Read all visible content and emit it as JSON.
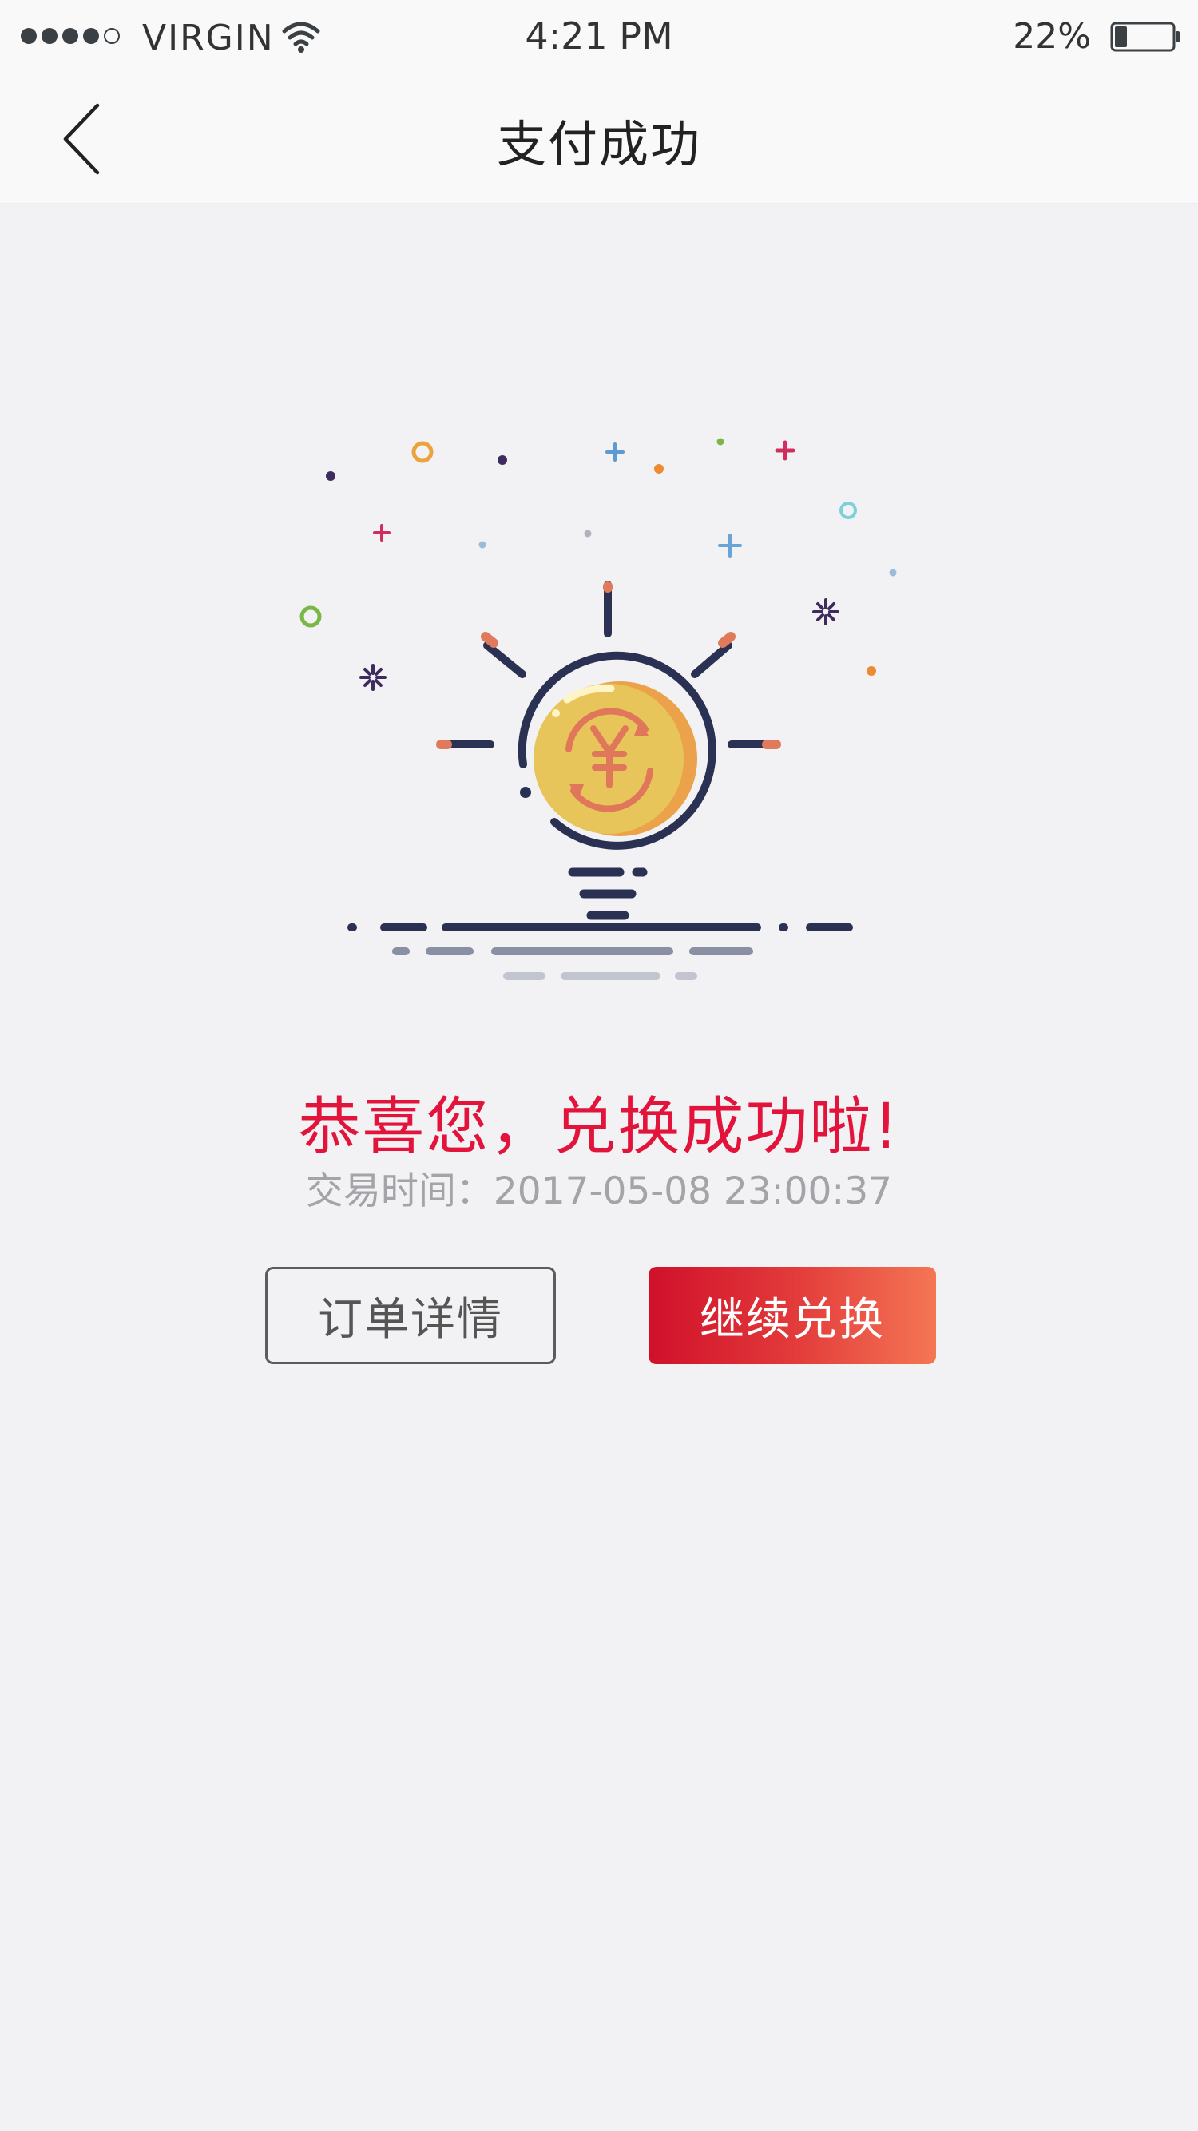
{
  "status_bar": {
    "signal_bars_filled": 4,
    "signal_bars_total": 5,
    "carrier": "VIRGIN",
    "wifi_icon": "wifi-icon",
    "time": "4:21 PM",
    "battery_percent": "22%",
    "battery_level": 0.22,
    "battery_icon": "battery-icon"
  },
  "nav": {
    "back_icon": "chevron-left-icon",
    "title": "支付成功"
  },
  "illustration": {
    "icon": "lightbulb-yen-coin-icon",
    "coin_symbol": "¥"
  },
  "result": {
    "headline": "恭喜您，兑换成功啦!",
    "time_label": "交易时间：",
    "time_value": "2017-05-08 23:00:37"
  },
  "actions": {
    "order_details_label": "订单详情",
    "continue_label": "继续兑换"
  },
  "colors": {
    "accent": "#e2143b",
    "button_gradient_start": "#d0102a",
    "button_gradient_end": "#f47654",
    "coin": "#e8c55a",
    "outline": "#2b3152"
  }
}
